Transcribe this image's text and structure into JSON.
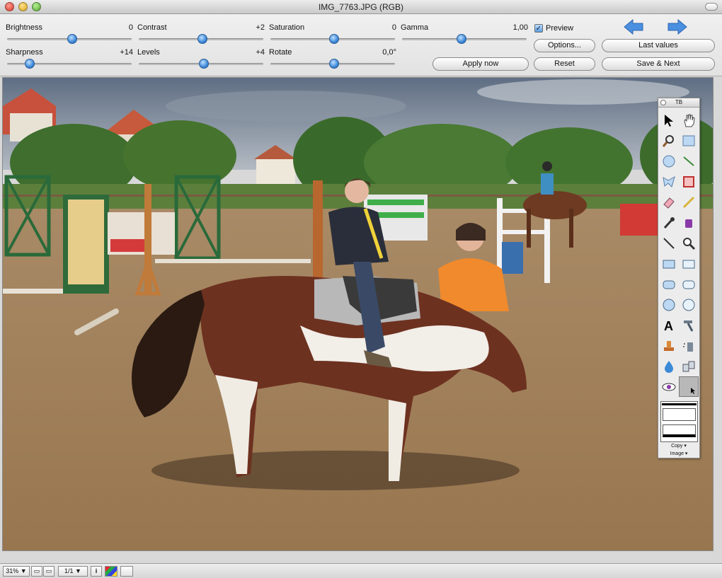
{
  "window": {
    "title": "IMG_7763.JPG (RGB)"
  },
  "adjustments": {
    "brightness": {
      "label": "Brightness",
      "value": "0",
      "level": 0.52
    },
    "contrast": {
      "label": "Contrast",
      "value": "+2",
      "level": 0.51
    },
    "saturation": {
      "label": "Saturation",
      "value": "0",
      "level": 0.51
    },
    "gamma": {
      "label": "Gamma",
      "value": "1,00",
      "level": 0.48
    },
    "sharpness": {
      "label": "Sharpness",
      "value": "+14",
      "level": 0.18
    },
    "levels": {
      "label": "Levels",
      "value": "+4",
      "level": 0.52
    },
    "rotate": {
      "label": "Rotate",
      "value": "0,0°",
      "level": 0.51
    }
  },
  "preview": {
    "label": "Preview",
    "checked": true
  },
  "buttons": {
    "options": "Options...",
    "last_values": "Last values",
    "apply_now": "Apply now",
    "reset": "Reset",
    "save_next": "Save & Next"
  },
  "palette": {
    "title": "TB",
    "footer_copy": "Copy ▾",
    "footer_image": "Image ▾"
  },
  "statusbar": {
    "zoom": "31% ▼",
    "page": "1/1 ▼",
    "info": "i"
  },
  "colors": {
    "accent": "#3d88d8",
    "arrow": "#4a8fe0"
  }
}
